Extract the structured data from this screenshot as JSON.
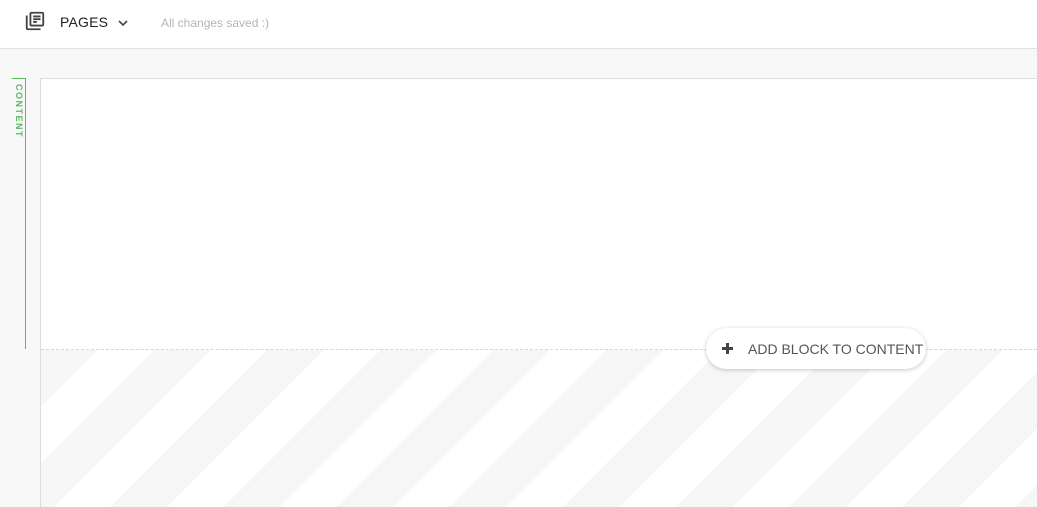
{
  "header": {
    "pages_icon": "library-books-icon",
    "pages_label": "PAGES",
    "dropdown_icon": "chevron-down-icon",
    "save_status": "All changes saved :)"
  },
  "sidebar": {
    "content_tab_label": "CONTENT"
  },
  "editor": {
    "add_block_icon": "plus-icon",
    "add_block_label": "ADD BLOCK TO CONTENT"
  },
  "colors": {
    "accent_green": "#5cb85c",
    "status_text": "#b5b5b5"
  }
}
